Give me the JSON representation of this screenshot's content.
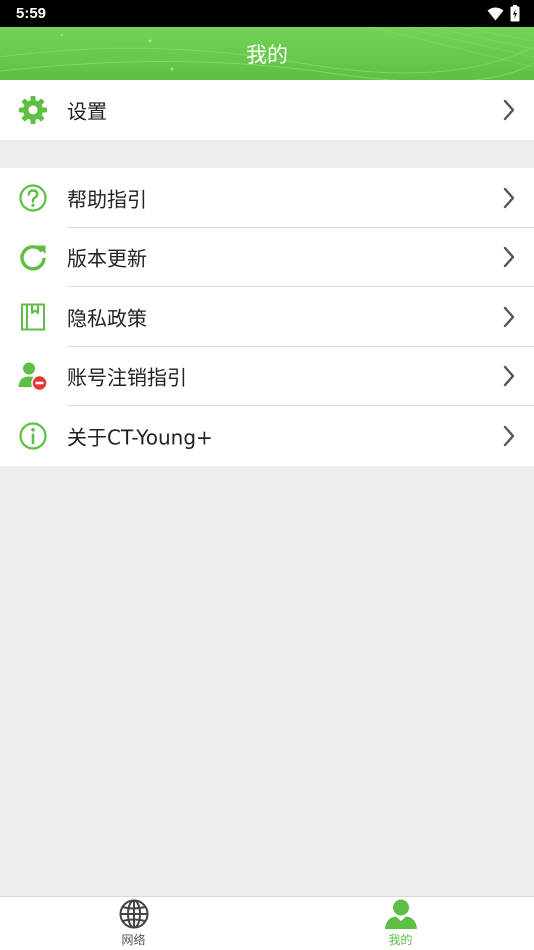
{
  "status_bar": {
    "time": "5:59"
  },
  "header": {
    "title": "我的"
  },
  "colors": {
    "accent": "#5dbf43",
    "header_green": "#66c84c",
    "badge_red": "#e53935",
    "text": "#222222",
    "inactive_tab": "#555555"
  },
  "settings_group": {
    "items": [
      {
        "label": "设置",
        "icon": "gear-icon"
      }
    ]
  },
  "menu_group": {
    "items": [
      {
        "label": "帮助指引",
        "icon": "question-circle-icon"
      },
      {
        "label": "版本更新",
        "icon": "refresh-icon"
      },
      {
        "label": "隐私政策",
        "icon": "bookmark-book-icon"
      },
      {
        "label": "账号注销指引",
        "icon": "user-remove-icon"
      },
      {
        "label": "关于CT-Young+",
        "icon": "info-circle-icon"
      }
    ]
  },
  "tabbar": {
    "tabs": [
      {
        "label": "网络",
        "icon": "globe-icon",
        "active": false
      },
      {
        "label": "我的",
        "icon": "user-icon",
        "active": true
      }
    ]
  }
}
